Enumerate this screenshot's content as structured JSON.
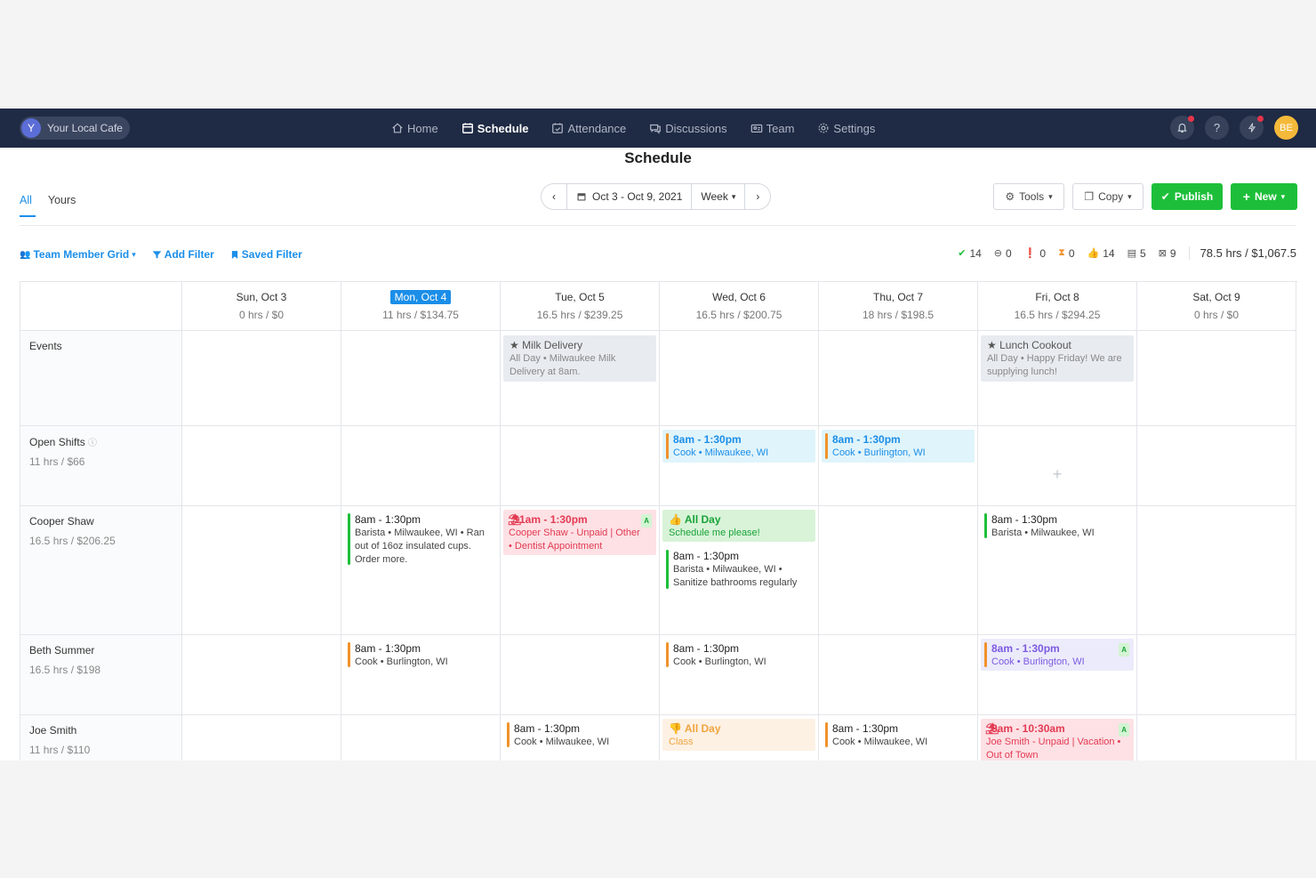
{
  "nav": {
    "brand_initial": "Y",
    "brand_name": "Your Local Cafe",
    "links": [
      "Home",
      "Schedule",
      "Attendance",
      "Discussions",
      "Team",
      "Settings"
    ],
    "user_initials": "BE"
  },
  "page_title": "Schedule",
  "tabs": [
    "All",
    "Yours"
  ],
  "date_nav": {
    "range": "Oct 3 - Oct 9, 2021",
    "view": "Week"
  },
  "toolbar": {
    "tools": "Tools",
    "copy": "Copy",
    "publish": "Publish",
    "new": "New"
  },
  "filters": {
    "grid": "Team Member Grid",
    "add_filter": "Add Filter",
    "saved_filter": "Saved Filter"
  },
  "stats": {
    "scheduled": "14",
    "minus": "0",
    "alert": "0",
    "pending": "0",
    "thumbs": "14",
    "notes": "5",
    "export": "9",
    "total": "78.5 hrs / $1,067.5"
  },
  "days": [
    {
      "label": "Sun, Oct 3",
      "hrs": "0 hrs / $0"
    },
    {
      "label": "Mon, Oct 4",
      "hrs": "11 hrs / $134.75"
    },
    {
      "label": "Tue, Oct 5",
      "hrs": "16.5 hrs / $239.25"
    },
    {
      "label": "Wed, Oct 6",
      "hrs": "16.5 hrs / $200.75"
    },
    {
      "label": "Thu, Oct 7",
      "hrs": "18 hrs / $198.5"
    },
    {
      "label": "Fri, Oct 8",
      "hrs": "16.5 hrs / $294.25"
    },
    {
      "label": "Sat, Oct 9",
      "hrs": "0 hrs / $0"
    }
  ],
  "rows": {
    "events": {
      "name": "Events"
    },
    "open": {
      "name": "Open Shifts",
      "hrs": "11 hrs / $66"
    },
    "cooper": {
      "name": "Cooper Shaw",
      "hrs": "16.5 hrs / $206.25"
    },
    "beth": {
      "name": "Beth Summer",
      "hrs": "16.5 hrs / $198"
    },
    "joe": {
      "name": "Joe Smith",
      "hrs": "11 hrs / $110"
    }
  },
  "cards": {
    "ev_tue": {
      "title": "Milk Delivery",
      "l1": "All Day • Milwaukee Milk",
      "l2": "Delivery at 8am."
    },
    "ev_fri": {
      "title": "Lunch Cookout",
      "l1": "All Day • Happy Friday! We are",
      "l2": "supplying lunch!"
    },
    "open_wed": {
      "time": "8am - 1:30pm",
      "sub": "Cook • Milwaukee, WI"
    },
    "open_thu": {
      "time": "8am - 1:30pm",
      "sub": "Cook • Burlington, WI"
    },
    "cooper_mon": {
      "time": "8am - 1:30pm",
      "l1": "Barista • Milwaukee, WI • Ran",
      "l2": "out of 16oz insulated cups.",
      "l3": "Order more."
    },
    "cooper_tue": {
      "time": "11am - 1:30pm",
      "badge": "A",
      "l1": "Cooper Shaw - Unpaid | Other",
      "l2": "• Dentist Appointment"
    },
    "cooper_wed_avail": {
      "title": "All Day",
      "sub": "Schedule me please!"
    },
    "cooper_wed": {
      "time": "8am - 1:30pm",
      "l1": "Barista • Milwaukee, WI •",
      "l2": "Sanitize bathrooms regularly"
    },
    "cooper_fri": {
      "time": "8am - 1:30pm",
      "sub": "Barista • Milwaukee, WI"
    },
    "beth_mon": {
      "time": "8am - 1:30pm",
      "sub": "Cook • Burlington, WI"
    },
    "beth_wed": {
      "time": "8am - 1:30pm",
      "sub": "Cook • Burlington, WI"
    },
    "beth_fri": {
      "time": "8am - 1:30pm",
      "badge": "A",
      "sub": "Cook • Burlington, WI"
    },
    "joe_tue": {
      "time": "8am - 1:30pm",
      "sub": "Cook • Milwaukee, WI"
    },
    "joe_wed": {
      "title": "All Day",
      "sub": "Class"
    },
    "joe_thu": {
      "time": "8am - 1:30pm",
      "sub": "Cook • Milwaukee, WI"
    },
    "joe_fri": {
      "time": "8am - 10:30am",
      "badge": "A",
      "l1": "Joe Smith - Unpaid | Vacation •",
      "l2": "Out of Town"
    }
  },
  "colors": {
    "nav": "#1f2a44",
    "accent": "#1b8ee8",
    "green": "#1dbf3a",
    "orange": "#f0922b",
    "red": "#e33a52",
    "purple": "#7c5ae0"
  }
}
